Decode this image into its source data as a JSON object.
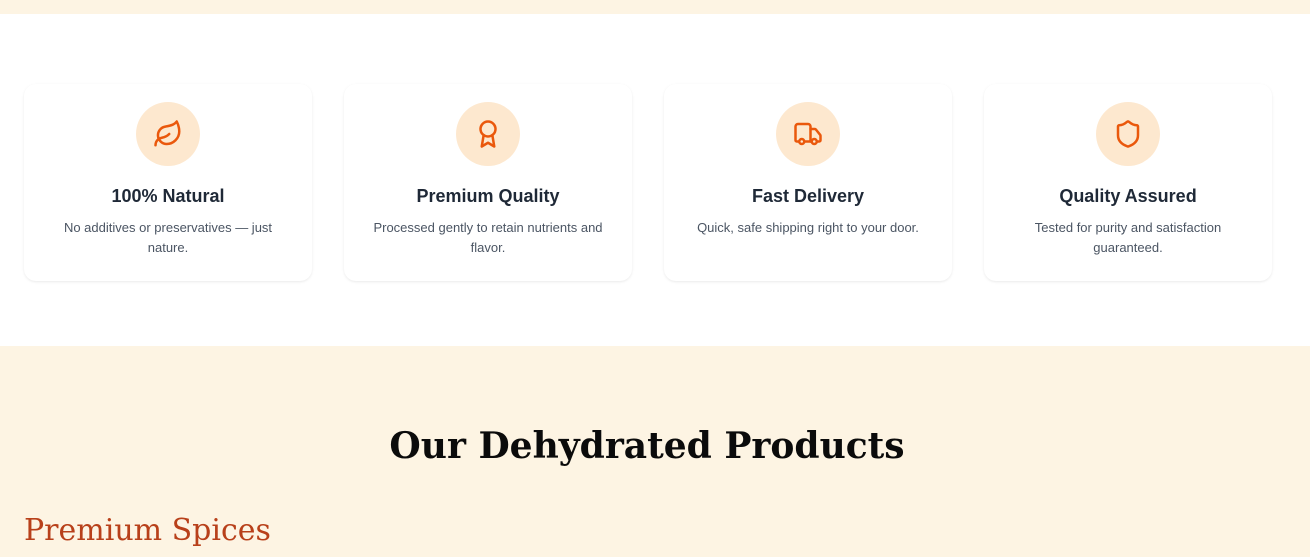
{
  "features": [
    {
      "icon": "leaf-icon",
      "title": "100% Natural",
      "description": "No additives or preservatives — just nature."
    },
    {
      "icon": "award-icon",
      "title": "Premium Quality",
      "description": "Processed gently to retain nutrients and flavor."
    },
    {
      "icon": "truck-icon",
      "title": "Fast Delivery",
      "description": "Quick, safe shipping right to your door."
    },
    {
      "icon": "shield-icon",
      "title": "Quality Assured",
      "description": "Tested for purity and satisfaction guaranteed."
    }
  ],
  "products": {
    "section_title": "Our Dehydrated Products",
    "category_title": "Premium Spices"
  },
  "colors": {
    "accent": "#ea580c",
    "icon_bg": "#fde8cf",
    "cream_bg": "#fdf4e3",
    "category_title": "#b8401a"
  }
}
